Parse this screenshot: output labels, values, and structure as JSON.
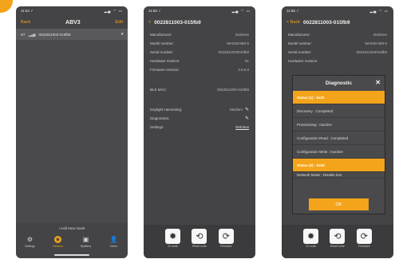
{
  "phone1": {
    "status_time": "11:54 ✓",
    "status_icons": "▂▄ ◠ ▭",
    "nav": {
      "back": "Back",
      "title": "ABV3",
      "edit": "Edit"
    },
    "device": {
      "id": "-67",
      "name": "0022811003-015fb9",
      "rssi": "▂▄▆"
    },
    "add_node": "+Add New Node",
    "tabs": [
      {
        "label": "Settings",
        "icon": "gear-icon"
      },
      {
        "label": "Devices",
        "icon": "devices-icon"
      },
      {
        "label": "Systems",
        "icon": "system-icon"
      },
      {
        "label": "Users",
        "icon": "user-icon"
      }
    ]
  },
  "phone2": {
    "status_time": "11:55 ✓",
    "status_icons": "▂▄ ◠ ▭",
    "nav": {
      "back": "<",
      "title": "0022811003-015fb9"
    },
    "details": [
      {
        "label": "Manufacturer:",
        "value": "Daintree"
      },
      {
        "label": "Model number:",
        "value": "WHS20-BM-5"
      },
      {
        "label": "Serial number:",
        "value": "0022811003015fb9"
      },
      {
        "label": "Hardware revision:",
        "value": "51"
      },
      {
        "label": "Firmware revision:",
        "value": "4.0.5.0"
      }
    ],
    "ble": {
      "label": "BLE MAC:",
      "value": "0022811003-015fb9"
    },
    "daylight": {
      "label": "Daylight Harvesting:",
      "value": "Medium"
    },
    "diagnostics": {
      "label": "Diagnostics:"
    },
    "settings": {
      "label": "Settings:",
      "value": "Retrieve"
    },
    "actions": [
      {
        "label": "ID node",
        "icon": "sun-icon"
      },
      {
        "label": "Reset node",
        "icon": "reset-icon"
      },
      {
        "label": "Firmware",
        "icon": "firmware-icon"
      }
    ]
  },
  "phone3": {
    "status_time": "11:56 ✓",
    "status_icons": "▂▄ ◠ ▭",
    "nav": {
      "back": "< Back",
      "title": "0022811003-015fb9"
    },
    "details": [
      {
        "label": "Manufacturer:",
        "value": "Daintree"
      },
      {
        "label": "Model number:",
        "value": "WHS20-BM-5"
      },
      {
        "label": "Serial number:",
        "value": "0022811003015fb9"
      },
      {
        "label": "Hardware revision:",
        "value": ""
      }
    ],
    "modal": {
      "title": "Diagnostic",
      "rows": [
        {
          "text": "Status (1) : 0x22",
          "highlight": true
        },
        {
          "text": "Discovery : Completed",
          "highlight": false
        },
        {
          "text": "Provisioning : Inactive",
          "highlight": false
        },
        {
          "text": "Configuration Read : Completed",
          "highlight": false
        },
        {
          "text": "Configuration Write : Inactive",
          "highlight": false
        },
        {
          "text": "Status (0) : 0x0d",
          "highlight": true
        },
        {
          "text": "Network Mode : Disable bus",
          "highlight": false
        }
      ],
      "ok": "OK"
    },
    "actions": [
      {
        "label": "ID node",
        "icon": "sun-icon"
      },
      {
        "label": "Reset node",
        "icon": "reset-icon"
      },
      {
        "label": "Firmware",
        "icon": "firmware-icon"
      }
    ]
  },
  "colors": {
    "accent": "#f3a41b",
    "screen_bg": "#444446",
    "modal_bg": "#4a4a4c"
  }
}
